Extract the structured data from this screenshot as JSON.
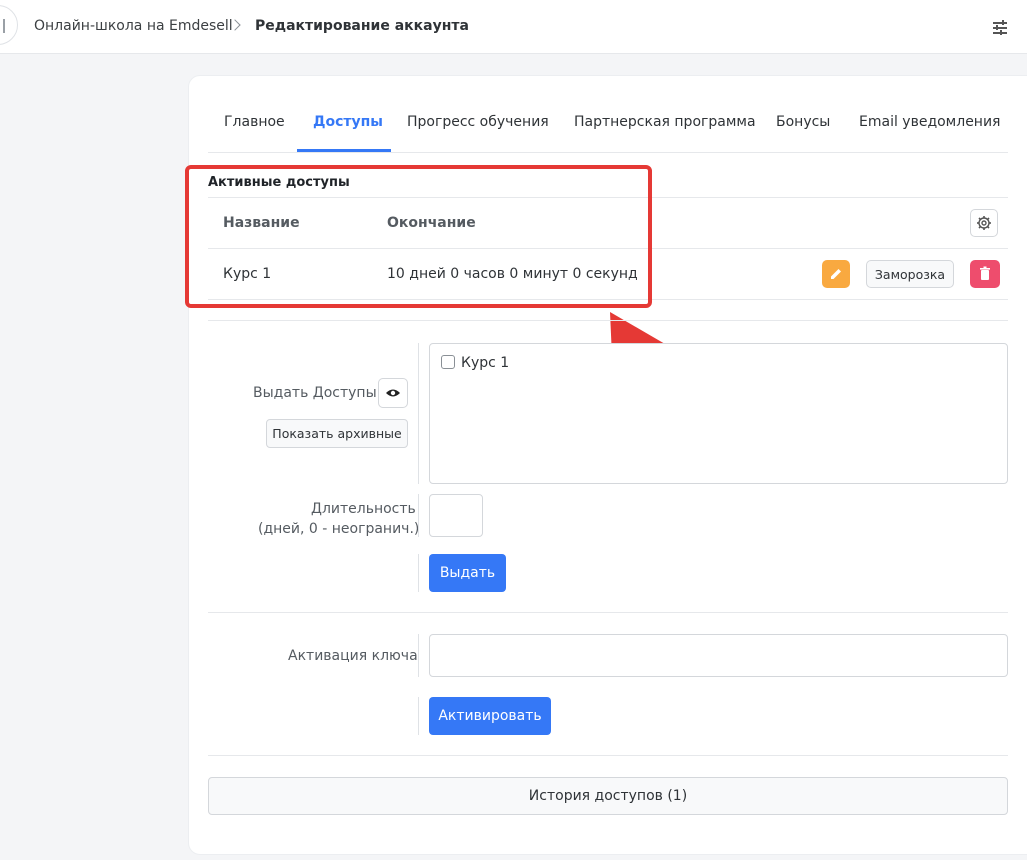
{
  "breadcrumb": {
    "root": "Онлайн-школа на Emdesell",
    "current": "Редактирование аккаунта"
  },
  "tabs": [
    {
      "label": "Главное",
      "active": false
    },
    {
      "label": "Доступы",
      "active": true
    },
    {
      "label": "Прогресс обучения",
      "active": false
    },
    {
      "label": "Партнерская программа",
      "active": false
    },
    {
      "label": "Бонусы",
      "active": false
    },
    {
      "label": "Email уведомления",
      "active": false
    }
  ],
  "active_access": {
    "title": "Активные доступы",
    "columns": [
      "Название",
      "Окончание"
    ],
    "rows": [
      {
        "name": "Курс 1",
        "ends": "10 дней 0 часов 0 минут 0 секунд",
        "freeze_label": "Заморозка"
      }
    ]
  },
  "grant": {
    "label": "Выдать Доступы",
    "show_archived_label": "Показать архивные",
    "courses": [
      {
        "label": "Курс 1",
        "checked": false
      }
    ],
    "duration_label_line1": "Длительность",
    "duration_label_line2": "(дней, 0 - неогранич.)",
    "duration_value": "",
    "submit_label": "Выдать"
  },
  "key": {
    "label": "Активация ключа",
    "value": "",
    "submit_label": "Активировать"
  },
  "history_label": "История доступов (1)",
  "colors": {
    "accent": "#3578f6",
    "edit": "#f9a940",
    "delete": "#ee4d6d",
    "annotation": "#e53935"
  }
}
